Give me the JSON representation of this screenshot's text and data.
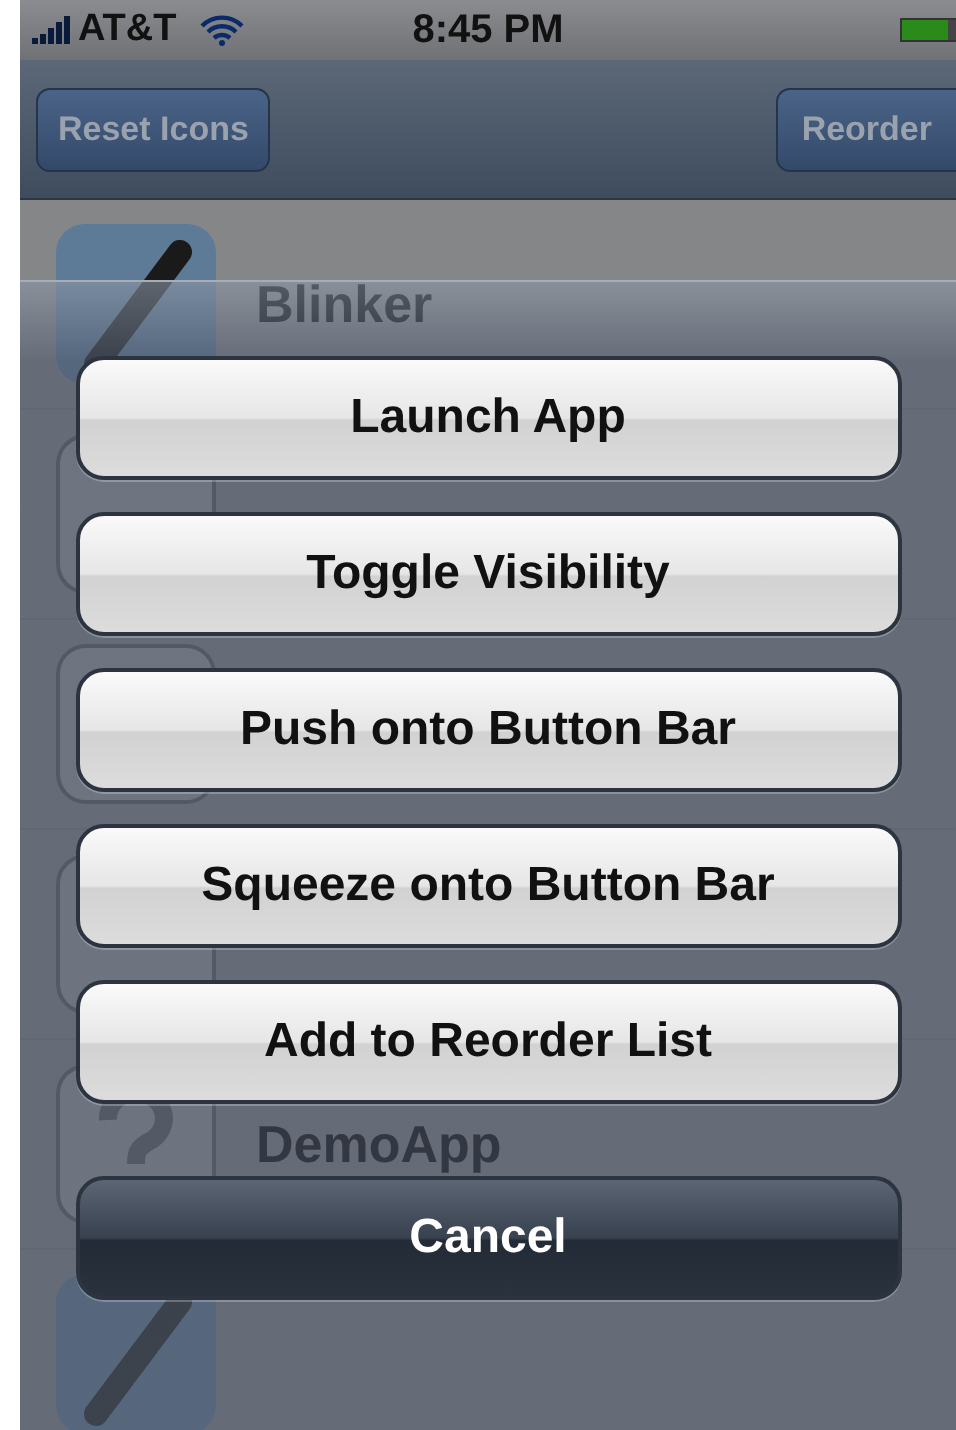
{
  "status_bar": {
    "carrier": "AT&T",
    "time": "8:45 PM"
  },
  "nav_bar": {
    "left_button": "Reset Icons",
    "right_button": "Reorder"
  },
  "app_list": [
    {
      "name": "Blinker",
      "kind": "pen"
    },
    {
      "kind": "blank"
    },
    {
      "kind": "blank"
    },
    {
      "kind": "blank"
    },
    {
      "name": "DemoApp",
      "kind": "question"
    },
    {
      "kind": "pen"
    }
  ],
  "action_sheet": {
    "buttons": [
      {
        "label": "Launch App",
        "kind": "default"
      },
      {
        "label": "Toggle Visibility",
        "kind": "default"
      },
      {
        "label": "Push onto Button Bar",
        "kind": "default"
      },
      {
        "label": "Squeeze onto Button Bar",
        "kind": "default"
      },
      {
        "label": "Add to Reorder List",
        "kind": "default"
      },
      {
        "label": "Cancel",
        "kind": "cancel"
      }
    ]
  }
}
